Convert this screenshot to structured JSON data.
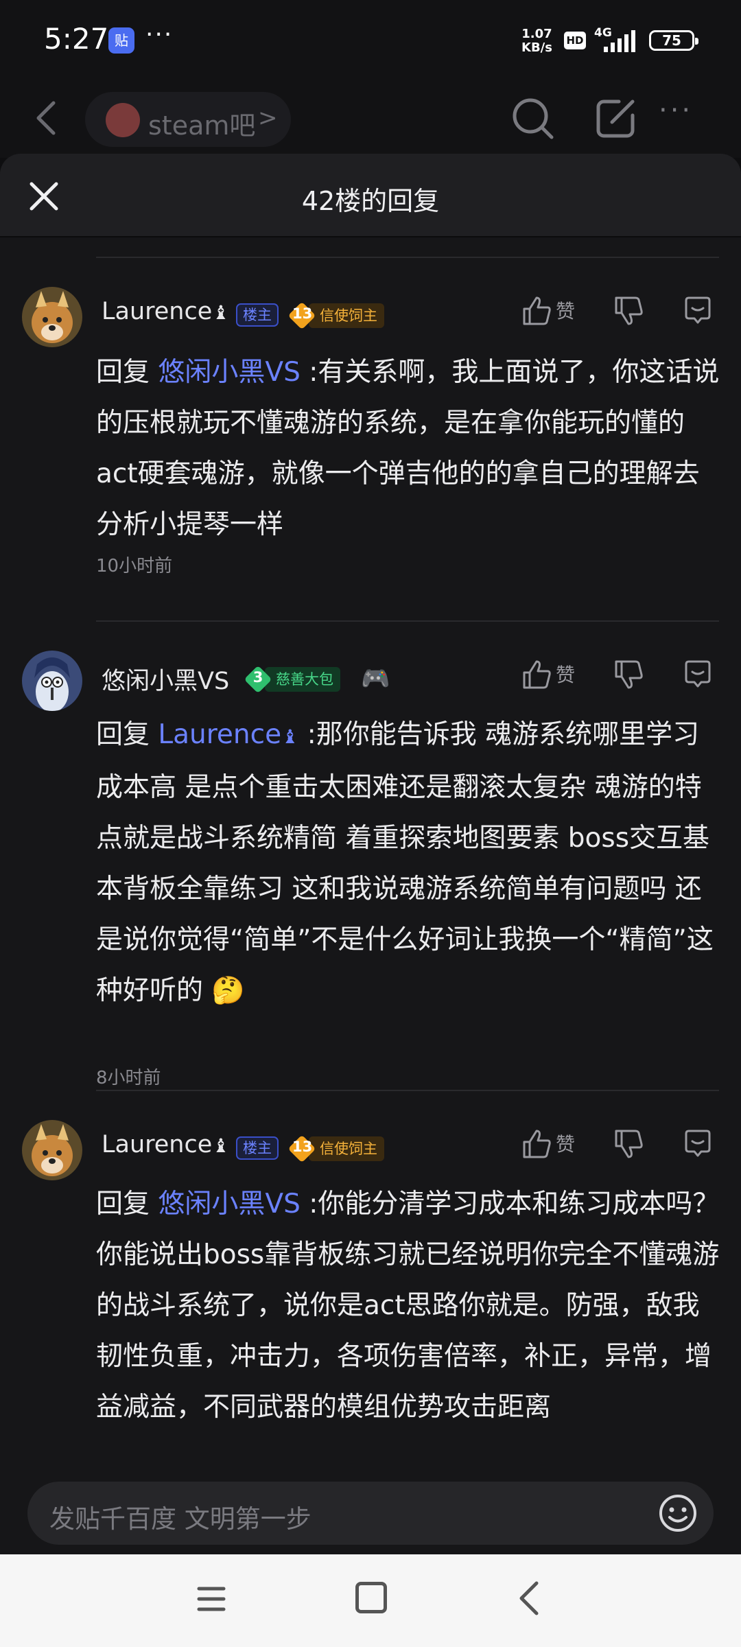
{
  "status": {
    "time": "5:27",
    "app_icon": "贴",
    "more": "···",
    "speed_value": "1.07",
    "speed_unit": "KB/s",
    "hd": "HD",
    "network": "4G",
    "battery": "75"
  },
  "header": {
    "forum_name": "steam吧",
    "chevron": ">",
    "more": "···"
  },
  "sheet": {
    "title": "42楼的回复"
  },
  "comments": [
    {
      "username": "Laurence",
      "owner_tag": "楼主",
      "level": "13",
      "level_title": "信使饲主",
      "like_label": "赞",
      "reply_prefix": "回复 ",
      "mention": "悠闲小黑VS",
      "text": " :有关系啊，我上面说了，你这话说的压根就玩不懂魂游的系统，是在拿你能玩的懂的act硬套魂游，就像一个弹吉他的的拿自己的理解去分析小提琴一样",
      "time": "10小时前"
    },
    {
      "username": "悠闲小黑VS",
      "level": "3",
      "level_title": "慈善大包",
      "badge_emoji": "🎮",
      "like_label": "赞",
      "reply_prefix": "回复 ",
      "mention": "Laurence",
      "text": " :那你能告诉我 魂游系统哪里学习成本高 是点个重击太困难还是翻滚太复杂 魂游的特点就是战斗系统精简 着重探索地图要素 boss交互基本背板全靠练习 这和我说魂游系统简单有问题吗 还是说你觉得“简单”不是什么好词让我换一个“精简”这种好听的 ",
      "end_emoji": "🤔",
      "time": "8小时前"
    },
    {
      "username": "Laurence",
      "owner_tag": "楼主",
      "level": "13",
      "level_title": "信使饲主",
      "like_label": "赞",
      "reply_prefix": "回复 ",
      "mention": "悠闲小黑VS",
      "text": " :你能分清学习成本和练习成本吗？你能说出boss靠背板练习就已经说明你完全不懂魂游的战斗系统了，说你是act思路你就是。防强，敌我韧性负重，冲击力，各项伤害倍率，补正，异常，增益减益，不同武器的模组优势攻击距离"
    }
  ],
  "input": {
    "placeholder": "发贴千百度 文明第一步"
  },
  "colors": {
    "mention": "#6b82ff",
    "level_gold": "#f2a21d",
    "level_green": "#2fbf6e",
    "background": "#161618"
  }
}
